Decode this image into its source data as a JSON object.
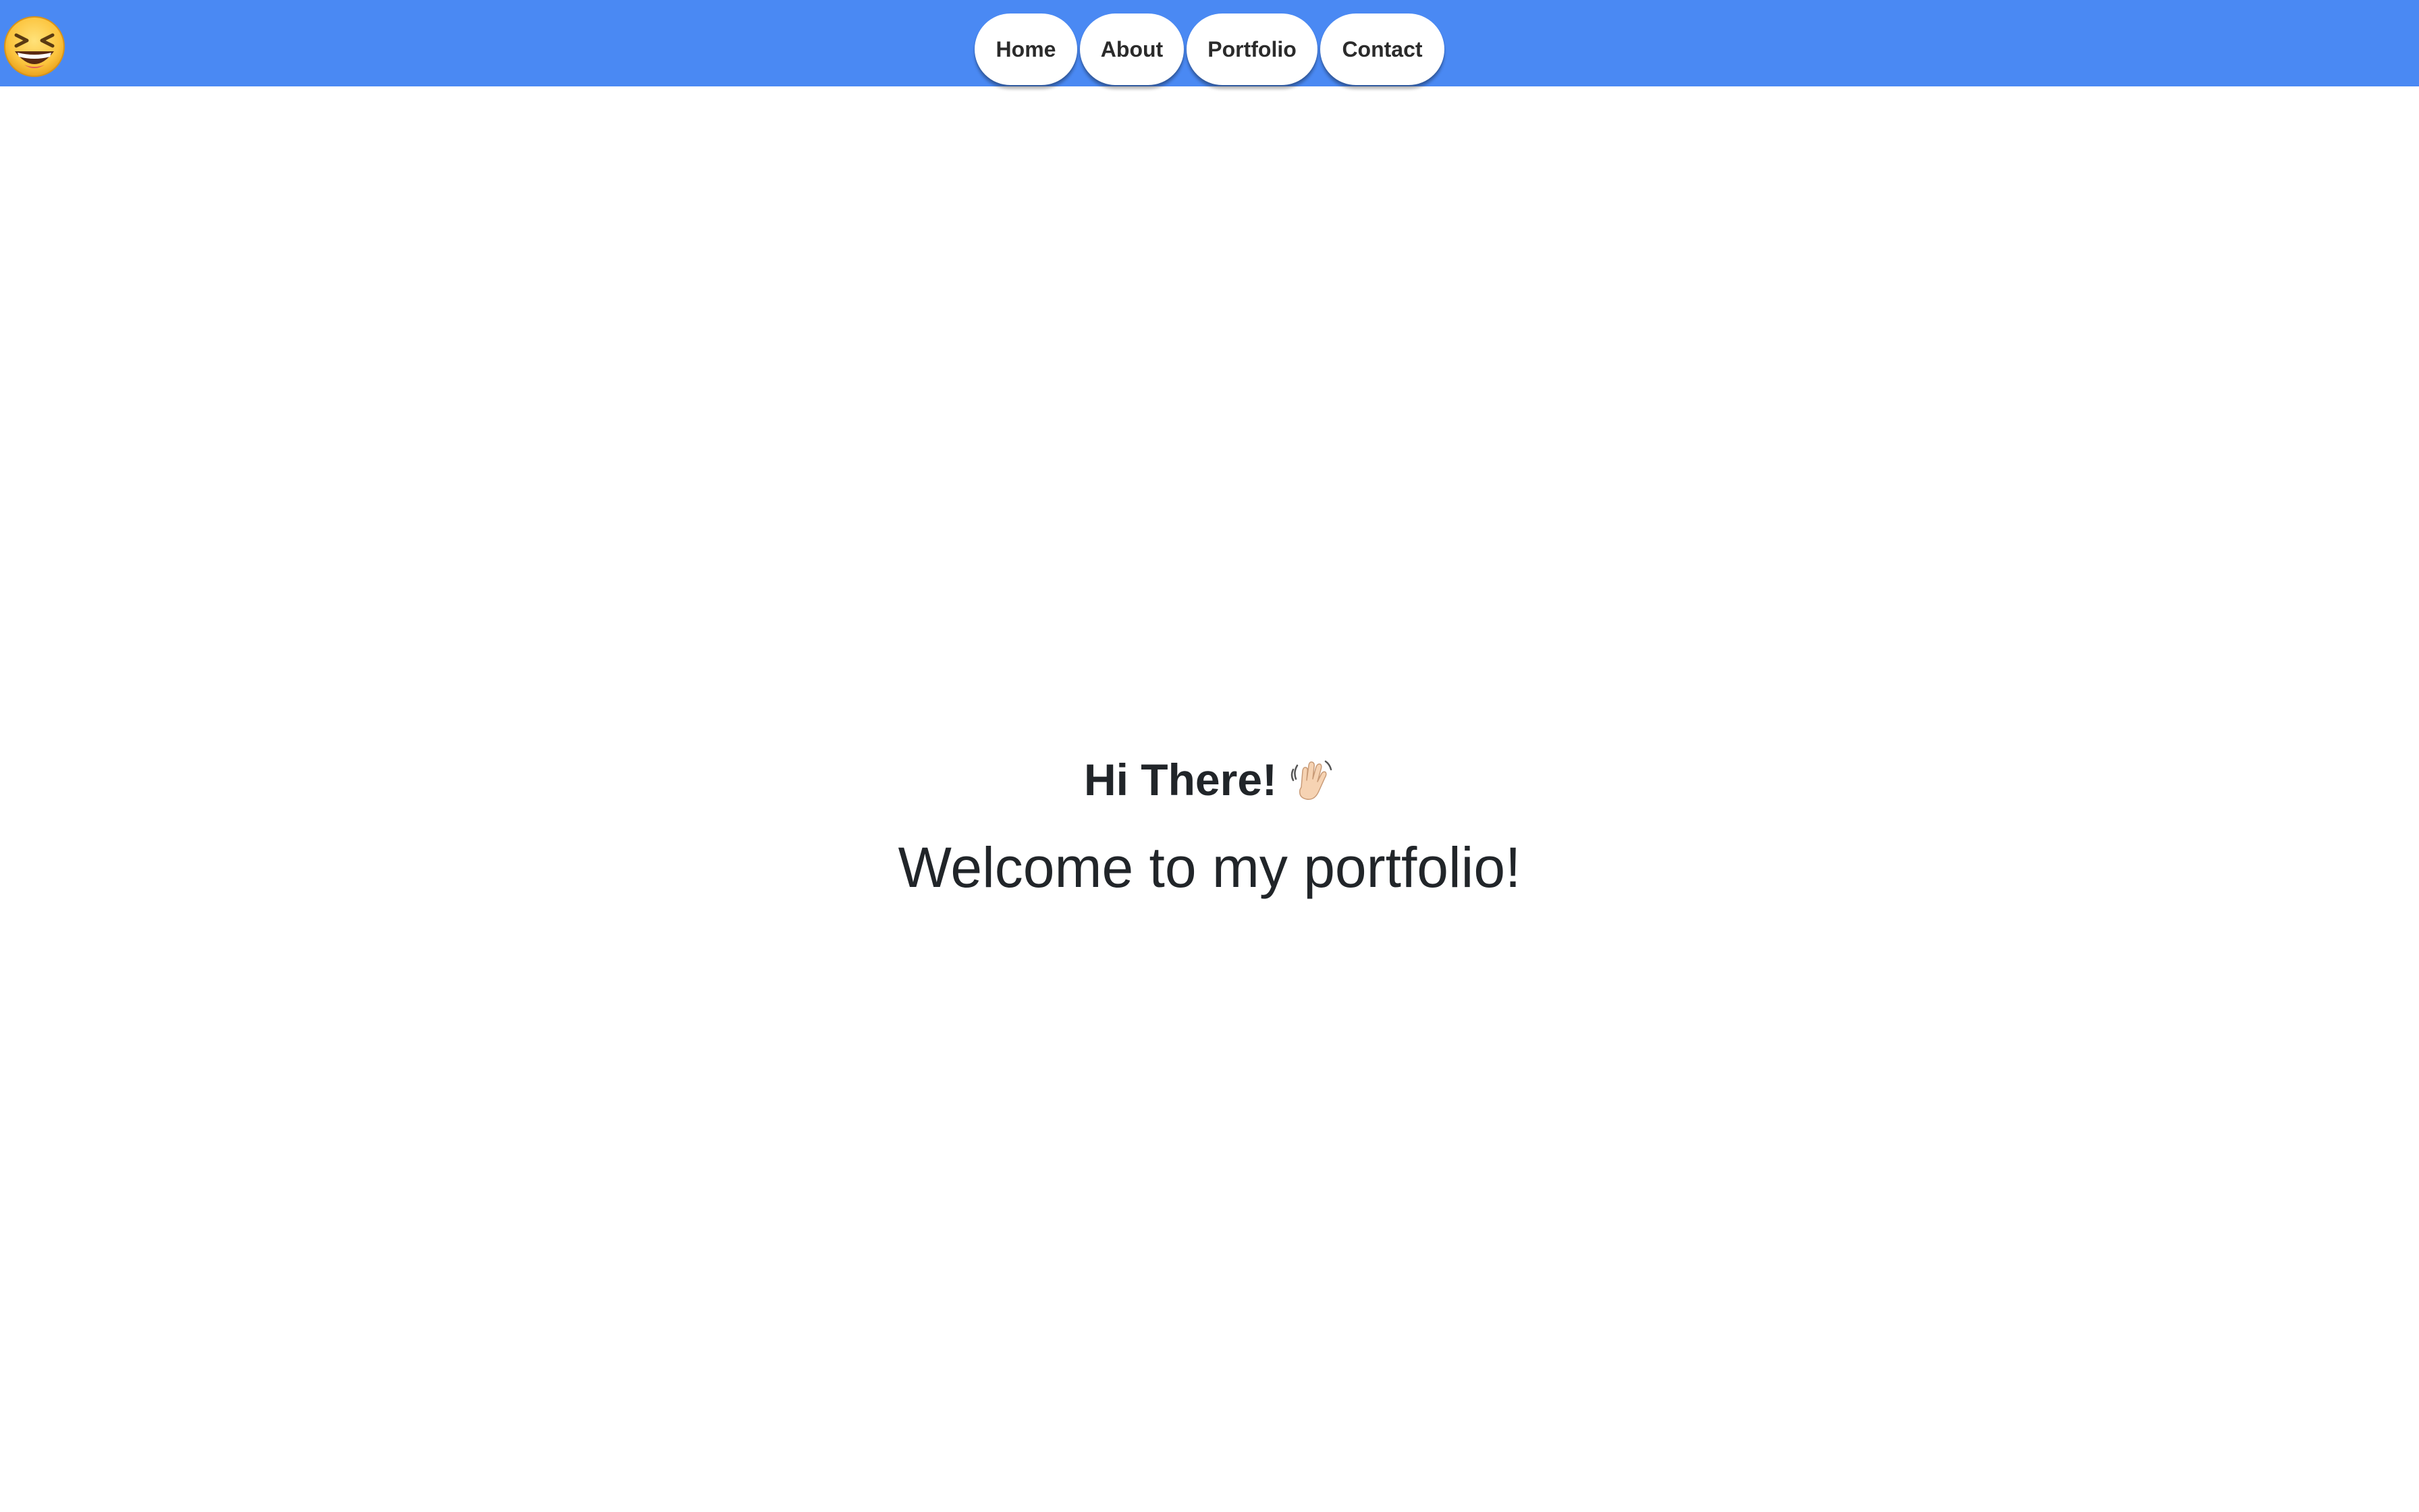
{
  "navbar": {
    "background": "#4a89f3",
    "logo_icon": "laughing-face-emoji",
    "items": [
      {
        "label": "Home"
      },
      {
        "label": "About"
      },
      {
        "label": "Portfolio"
      },
      {
        "label": "Contact"
      }
    ]
  },
  "hero": {
    "greeting": "Hi There!",
    "greeting_icon": "waving-hand-emoji",
    "welcome": "Welcome to my portfolio!"
  }
}
